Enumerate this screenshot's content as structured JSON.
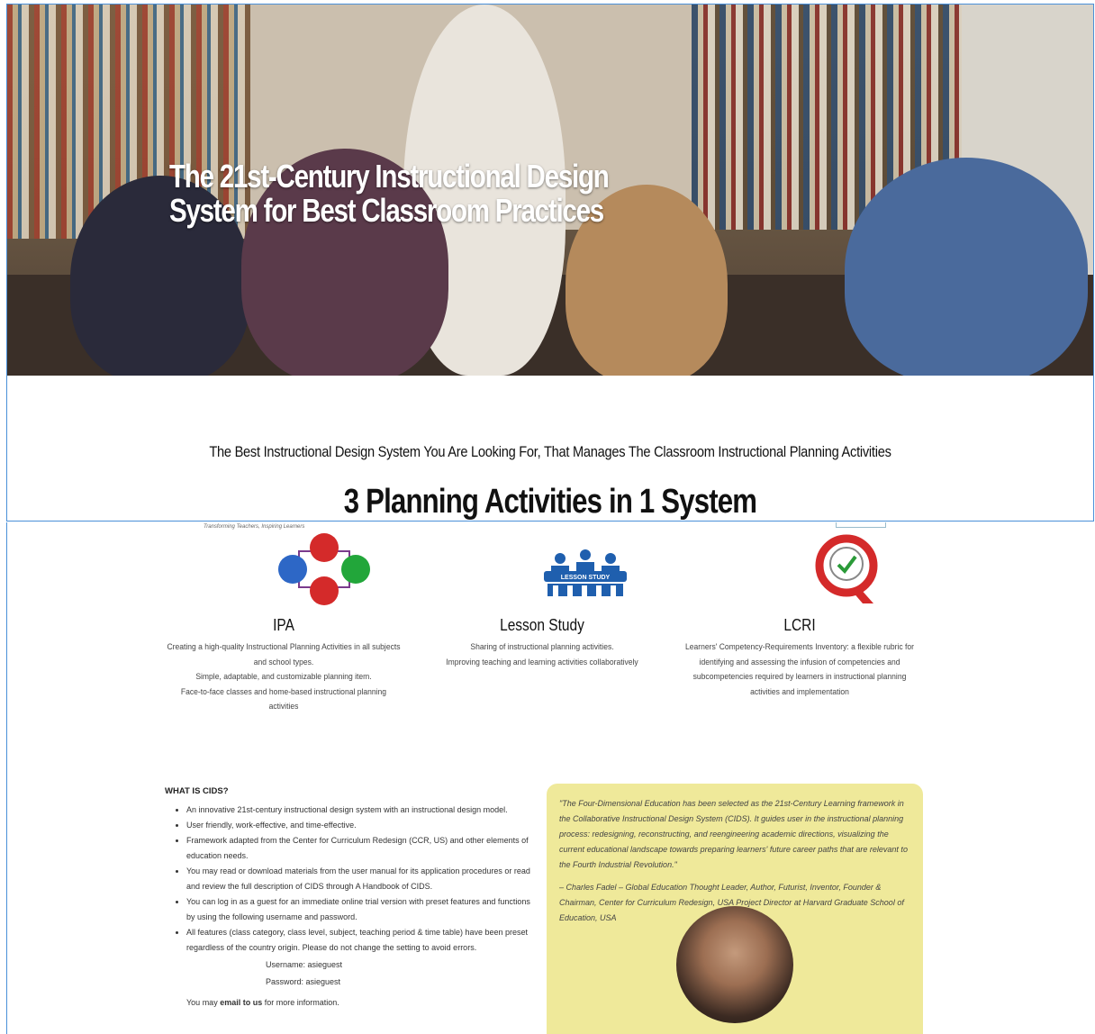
{
  "hero": {
    "title": "The 21st-Century Instructional Design System for Best Classroom Practices"
  },
  "tagline": "The Best Instructional Design System You Are Looking For, That Manages The Classroom Instructional Planning Activities",
  "section_heading": "3 Planning Activities in 1 System",
  "header_fragment": "Transforming Teachers, Inspiring Learners",
  "features": [
    {
      "title": "IPA",
      "lines": [
        "Creating a high-quality Instructional Planning Activities in all subjects and school types.",
        "Simple, adaptable, and customizable planning item.",
        "Face-to-face classes and home-based instructional planning activities"
      ]
    },
    {
      "title": "Lesson Study",
      "icon_label": "LESSON STUDY",
      "lines": [
        "Sharing of instructional planning activities.",
        "Improving teaching and learning activities collaboratively"
      ]
    },
    {
      "title": "LCRI",
      "lines": [
        "Learners' Competency-Requirements Inventory: a flexible rubric for identifying and assessing the infusion of competencies and subcompetencies required by learners in instructional planning activities and implementation"
      ]
    }
  ],
  "what_is": {
    "heading": "WHAT IS CIDS?",
    "items": [
      "An innovative 21st-century instructional design system with an instructional design model.",
      "User friendly, work-effective, and time-effective.",
      "Framework adapted from the Center for Curriculum Redesign (CCR, US) and other elements of education needs.",
      "You may read or download materials from the user manual for its application procedures or read and review the full description of CIDS through A Handbook of CIDS.",
      "You can log in as a guest for an immediate online trial version with preset features and functions by using the following username and password.",
      "All features (class category, class level, subject, teaching period & time table) have been preset regardless of the country origin. Please do not change the setting to avoid errors."
    ],
    "username": "Username: asieguest",
    "password": "Password: asieguest",
    "email_prefix": "You may",
    "email_link": "email to us",
    "email_suffix": "for more information."
  },
  "quote": {
    "text": "\"The Four-Dimensional Education has been selected as the 21st-Century Learning framework in the Collaborative Instructional Design System (CIDS). It guides user in the instructional planning process: redesigning, reconstructing, and reengineering academic directions, visualizing the current educational landscape towards preparing learners' future career paths that are relevant to the Fourth Industrial Revolution.\"",
    "attribution": "– Charles Fadel – Global Education Thought Leader, Author, Futurist, Inventor, Founder & Chairman, Center for Curriculum Redesign, USA Project Director at Harvard Graduate School of Education, USA"
  },
  "colors": {
    "quote_bg": "#efe99a",
    "frame_border": "#4a90d9",
    "lcri_red": "#d42a2a",
    "lesson_blue": "#1f5fae"
  }
}
